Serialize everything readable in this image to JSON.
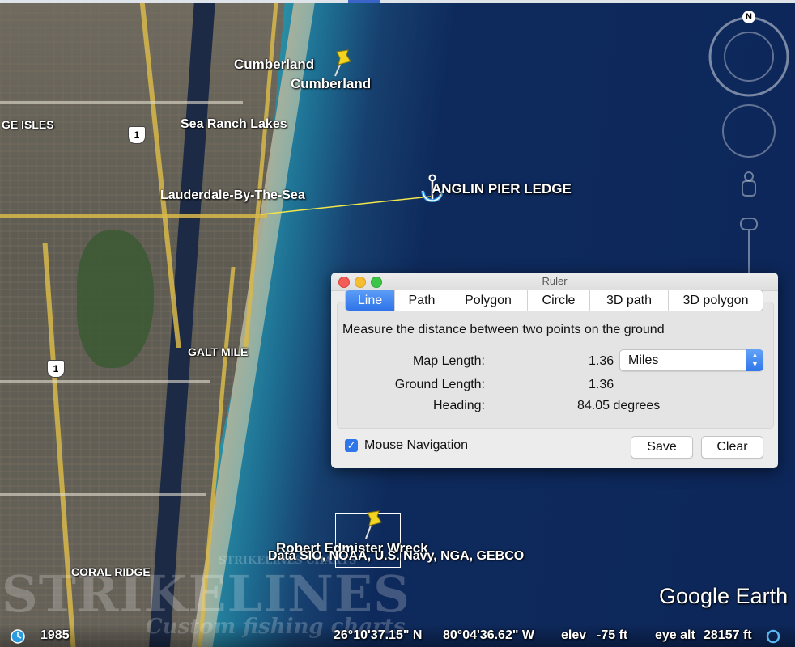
{
  "map": {
    "places": {
      "cumberland_1": "Cumberland",
      "cumberland_2": "Cumberland",
      "ge_isles": "GE ISLES",
      "sea_ranch_lakes": "Sea Ranch Lakes",
      "lauderdale": "Lauderdale-By-The-Sea",
      "galt_mile": "GALT MILE",
      "coral_ridge": "CORAL RIDGE"
    },
    "placemarks": {
      "anglin": "ANGLIN PIER LEDGE",
      "wreck": "Robert Edmister Wreck"
    },
    "road_shield": "1",
    "attribution": "Data SIO, NOAA, U.S. Navy, NGA, GEBCO",
    "brand": "Google Earth",
    "compass_letter": "N",
    "watermark": {
      "title": "STRIKELINES",
      "subtitle": "Custom fishing charts",
      "small": "STRIKELINES CHARTS"
    }
  },
  "status_bar": {
    "year": "1985",
    "lat": "26°10'37.15\" N",
    "lon": "80°04'36.62\" W",
    "elev_label": "elev",
    "elev_value": "-75 ft",
    "eye_alt_label": "eye alt",
    "eye_alt_value": "28157 ft"
  },
  "ruler": {
    "title": "Ruler",
    "tabs": [
      "Line",
      "Path",
      "Polygon",
      "Circle",
      "3D path",
      "3D polygon"
    ],
    "active_tab": "Line",
    "description": "Measure the distance between two points on the ground",
    "map_length_label": "Map Length:",
    "map_length_value": "1.36",
    "unit": "Miles",
    "ground_length_label": "Ground Length:",
    "ground_length_value": "1.36",
    "heading_label": "Heading:",
    "heading_value": "84.05 degrees",
    "mouse_nav_label": "Mouse Navigation",
    "mouse_nav_checked": true,
    "save_label": "Save",
    "clear_label": "Clear"
  },
  "colors": {
    "accent": "#2f76ea",
    "measure_line": "#f2e64a",
    "pin": "#f3d51f"
  }
}
